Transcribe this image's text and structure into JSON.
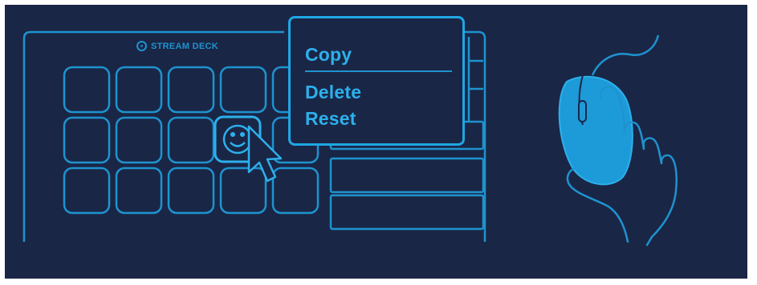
{
  "device": {
    "brand_text": "STREAM DECK",
    "brand_icon": "elgato-logo-icon",
    "key_rows": 3,
    "key_cols": 5,
    "smiley_key": "smiley-face-icon"
  },
  "context_menu": {
    "items": [
      {
        "label": "Copy"
      },
      {
        "label": "Delete"
      },
      {
        "label": "Reset"
      }
    ]
  },
  "illustration": {
    "cursor_icon": "pointer-cursor-icon",
    "mouse_icon": "computer-mouse-icon",
    "hand_icon": "hand-icon"
  },
  "colors": {
    "background": "#1a2646",
    "line": "#1e93cf",
    "accent": "#2cb0ec",
    "mouse_fill": "#1d9ad8"
  }
}
